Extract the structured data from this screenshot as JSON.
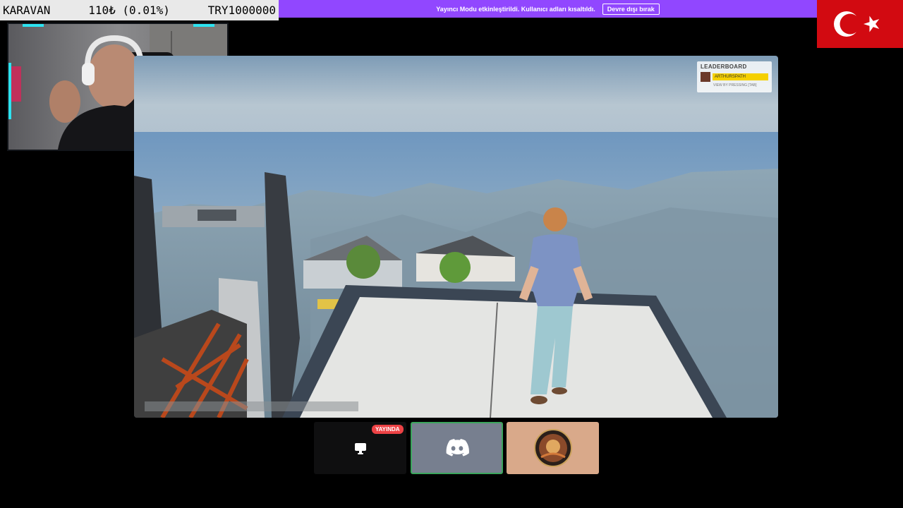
{
  "ticker": {
    "name": "KARAVAN",
    "price": "110₺ (0.01%)",
    "total": "TRY1000000"
  },
  "banner": {
    "message": "Yayıncı Modu etkinleştirildi. Kullanıcı adları kısaltıldı.",
    "disable_label": "Devre dışı bırak"
  },
  "leaderboard": {
    "title": "LEADERBOARD",
    "player": "ARTHURSPATH",
    "hint": "VIEW BY PRESSING [TAB]"
  },
  "bottom": {
    "live_badge": "YAYINDA"
  },
  "colors": {
    "banner": "#9147ff",
    "flag": "#d20a11",
    "discord_tile": "#777f8f",
    "live": "#ed4245",
    "accent": "#2de3f0"
  }
}
